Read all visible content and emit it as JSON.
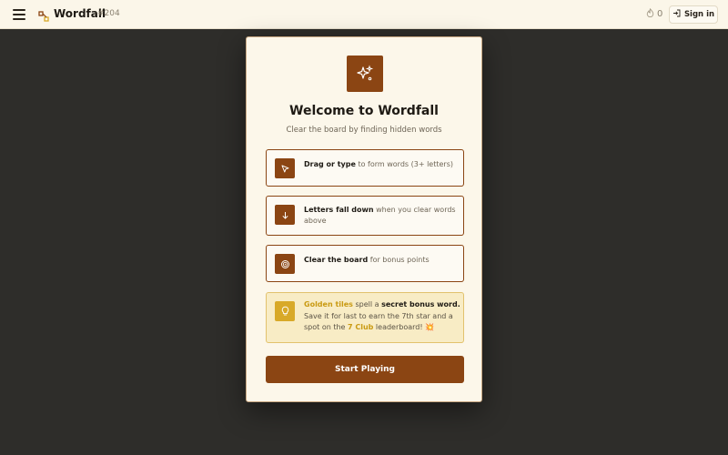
{
  "header": {
    "app_title": "Wordfall",
    "puzzle_number": "#204",
    "streak_count": "0",
    "signin_label": "Sign in"
  },
  "modal": {
    "title": "Welcome to Wordfall",
    "subtitle": "Clear the board by finding hidden words",
    "rules": [
      {
        "icon": "cursor-icon",
        "bold": "Drag or type",
        "text": " to form words (3+ letters)"
      },
      {
        "icon": "arrow-down-icon",
        "bold": "Letters fall down",
        "text": " when you clear words above"
      },
      {
        "icon": "target-icon",
        "bold": "Clear the board",
        "text": " for bonus points"
      }
    ],
    "tip": {
      "icon": "lightbulb-icon",
      "gold_1": "Golden tiles",
      "text_1": " spell a ",
      "bold_1": "secret bonus word.",
      "text_2": " Save it for last to earn the 7th star and a spot on the ",
      "gold_2": "7 Club",
      "text_3": " leaderboard! ",
      "emoji": "💥"
    },
    "start_label": "Start Playing"
  },
  "colors": {
    "accent": "#8b4513",
    "gold": "#d8a928",
    "background": "#2e2d2a",
    "panel": "#fcf7ea"
  }
}
